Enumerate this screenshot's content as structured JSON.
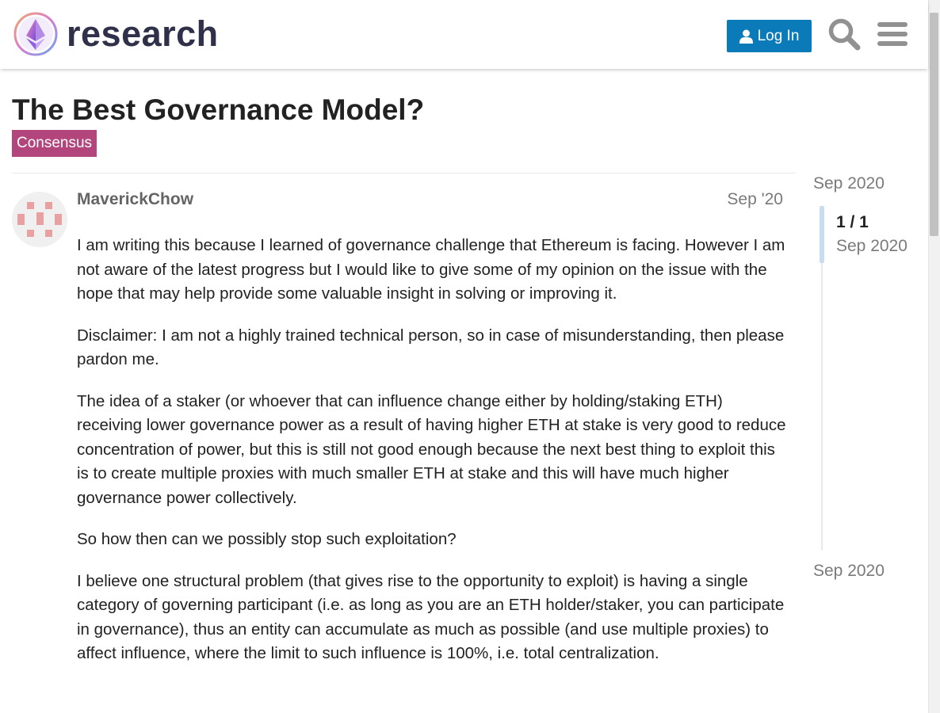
{
  "header": {
    "site_name": "research",
    "login_label": "Log In",
    "icons": [
      "logo-icon",
      "user-icon",
      "search-icon",
      "hamburger-menu-icon"
    ]
  },
  "topic": {
    "title": "The Best Governance Model?",
    "category": "Consensus",
    "category_color": "#b3457d"
  },
  "post": {
    "author": "MaverickChow",
    "date": "Sep '20",
    "paragraphs": [
      "I am writing this because I learned of governance challenge that Ethereum is facing. However I am not aware of the latest progress but I would like to give some of my opinion on the issue with the hope that may help provide some valuable insight in solving or improving it.",
      "Disclaimer: I am not a highly trained technical person, so in case of misunderstanding, then please pardon me.",
      "The idea of a staker (or whoever that can influence change either by holding/staking ETH) receiving lower governance power as a result of having higher ETH at stake is very good to reduce concentration of power, but this is still not good enough because the next best thing to exploit this is to create multiple proxies with much smaller ETH at stake and this will have much higher governance power collectively.",
      "So how then can we possibly stop such exploitation?",
      "I believe one structural problem (that gives rise to the opportunity to exploit) is having a single category of governing participant (i.e. as long as you are an ETH holder/staker, you can participate in governance), thus an entity can accumulate as much as possible (and use multiple proxies) to affect influence, where the limit to such influence is 100%, i.e. total centralization."
    ]
  },
  "timeline": {
    "start_label": "Sep 2020",
    "count": "1 / 1",
    "current_date": "Sep 2020",
    "end_label": "Sep 2020"
  },
  "colors": {
    "login_button": "#0a7ab8",
    "timeline_handle": "#c8def0"
  }
}
